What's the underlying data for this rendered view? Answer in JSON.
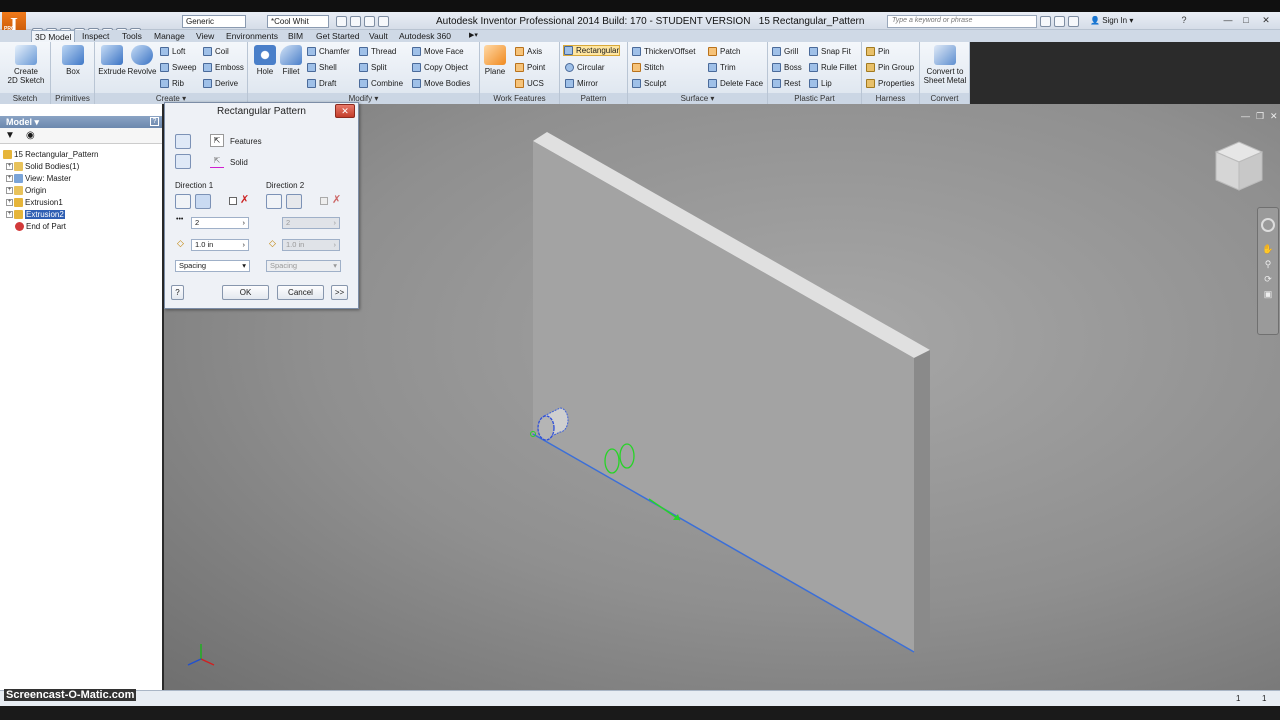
{
  "app": {
    "logo_letter": "I",
    "logo_sub": "PRO",
    "title": "Autodesk Inventor Professional 2014 Build: 170 - STUDENT VERSION",
    "document": "15 Rectangular_Pattern",
    "material_combo": "Generic",
    "appearance_combo": "*Cool Whit",
    "search_placeholder": "Type a keyword or phrase",
    "sign_in": "Sign In"
  },
  "tabs": [
    "3D Model",
    "Inspect",
    "Tools",
    "Manage",
    "View",
    "Environments",
    "BIM",
    "Get Started",
    "Vault",
    "Autodesk 360"
  ],
  "active_tab": "3D Model",
  "ribbon": {
    "sketch": {
      "title": "Sketch",
      "create_line1": "Create",
      "create_line2": "2D Sketch"
    },
    "primitives": {
      "title": "Primitives",
      "box": "Box"
    },
    "create": {
      "title": "Create",
      "extrude": "Extrude",
      "revolve": "Revolve",
      "loft": "Loft",
      "sweep": "Sweep",
      "rib": "Rib",
      "coil": "Coil",
      "emboss": "Emboss",
      "derive": "Derive"
    },
    "modify": {
      "title": "Modify",
      "hole": "Hole",
      "fillet": "Fillet",
      "chamfer": "Chamfer",
      "shell": "Shell",
      "draft": "Draft",
      "thread": "Thread",
      "split": "Split",
      "combine": "Combine",
      "move_face": "Move Face",
      "copy_object": "Copy Object",
      "move_bodies": "Move Bodies"
    },
    "work_features": {
      "title": "Work Features",
      "plane": "Plane",
      "axis": "Axis",
      "point": "Point",
      "ucs": "UCS"
    },
    "pattern": {
      "title": "Pattern",
      "rectangular": "Rectangular",
      "circular": "Circular",
      "mirror": "Mirror"
    },
    "surface": {
      "title": "Surface",
      "thicken": "Thicken/Offset",
      "stitch": "Stitch",
      "sculpt": "Sculpt",
      "patch": "Patch",
      "trim": "Trim",
      "delete_face": "Delete Face"
    },
    "plastic_part": {
      "title": "Plastic Part",
      "grill": "Grill",
      "boss": "Boss",
      "rest": "Rest",
      "snap_fit": "Snap Fit",
      "rule_fillet": "Rule Fillet",
      "lip": "Lip"
    },
    "harness": {
      "title": "Harness",
      "pin": "Pin",
      "pin_group": "Pin Group",
      "properties": "Properties"
    },
    "convert": {
      "title": "Convert",
      "line1": "Convert to",
      "line2": "Sheet Metal"
    }
  },
  "browser": {
    "header": "Model",
    "items": [
      {
        "label": "15 Rectangular_Pattern",
        "indent": 0,
        "icon": "part-icon"
      },
      {
        "label": "Solid Bodies(1)",
        "indent": 1,
        "icon": "folder-icon"
      },
      {
        "label": "View: Master",
        "indent": 1,
        "icon": "view-icon"
      },
      {
        "label": "Origin",
        "indent": 1,
        "icon": "folder-icon"
      },
      {
        "label": "Extrusion1",
        "indent": 1,
        "icon": "extrusion-icon"
      },
      {
        "label": "Extrusion2",
        "indent": 1,
        "icon": "extrusion-icon",
        "selected": true
      },
      {
        "label": "End of Part",
        "indent": 1,
        "icon": "end-of-part-icon"
      }
    ]
  },
  "dialog": {
    "title": "Rectangular Pattern",
    "features_label": "Features",
    "solid_label": "Solid",
    "direction1": {
      "title": "Direction 1",
      "count": "2",
      "spacing": "1.0 in",
      "method": "Spacing"
    },
    "direction2": {
      "title": "Direction 2",
      "count": "2",
      "spacing": "1.0 in",
      "method": "Spacing"
    },
    "ok": "OK",
    "cancel": "Cancel",
    "more": ">>",
    "help": "?"
  },
  "status": {
    "count1": "1",
    "count2": "1"
  },
  "watermark": "Screencast-O-Matic.com",
  "colors": {
    "accent": "#2f5fb3",
    "selection": "#3b6fd8",
    "preview": "#27d427",
    "plate": "#a3a3a3"
  }
}
